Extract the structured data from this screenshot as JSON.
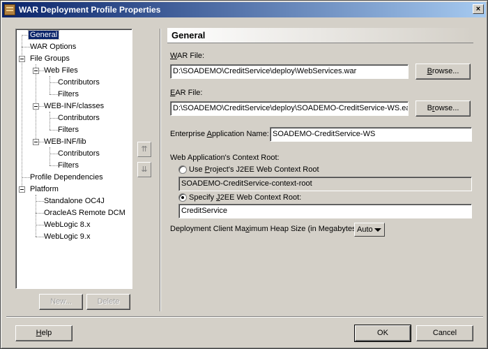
{
  "window": {
    "title": "WAR Deployment Profile Properties",
    "close_glyph": "×"
  },
  "tree": {
    "general": "General",
    "war_options": "WAR Options",
    "file_groups": "File Groups",
    "web_files": "Web Files",
    "web_files_contributors": "Contributors",
    "web_files_filters": "Filters",
    "web_inf_classes": "WEB-INF/classes",
    "classes_contributors": "Contributors",
    "classes_filters": "Filters",
    "web_inf_lib": "WEB-INF/lib",
    "lib_contributors": "Contributors",
    "lib_filters": "Filters",
    "profile_dependencies": "Profile Dependencies",
    "platform": "Platform",
    "standalone_oc4j": "Standalone OC4J",
    "oracleas_remote_dcm": "OracleAS Remote DCM",
    "weblogic_8x": "WebLogic 8.x",
    "weblogic_9x": "WebLogic 9.x"
  },
  "tree_buttons": {
    "new": "New...",
    "delete": "Delete",
    "move_up": "⇈",
    "move_down": "⇊"
  },
  "panel": {
    "header": "General",
    "war_file_label_u": "W",
    "war_file_label_rest": "AR File:",
    "war_file_value": "D:\\SOADEMO\\CreditService\\deploy\\WebServices.war",
    "browse1": "Browse...",
    "ear_file_label_u": "E",
    "ear_file_label_rest": "AR File:",
    "ear_file_value": "D:\\SOADEMO\\CreditService\\deploy\\SOADEMO-CreditService-WS.ear",
    "browse2": "Browse...",
    "enterprise_app_label_a": "Enterprise ",
    "enterprise_app_label_u": "A",
    "enterprise_app_label_b": "pplication Name:",
    "enterprise_app_value": "SOADEMO-CreditService-WS",
    "context_root_label": "Web Application's Context Root:",
    "use_project_label_a": "Use ",
    "use_project_label_u": "P",
    "use_project_label_b": "roject's J2EE Web Context Root",
    "project_root_value": "SOADEMO-CreditService-context-root",
    "specify_label_a": "Specify ",
    "specify_label_u": "J",
    "specify_label_b": "2EE Web Context Root:",
    "specify_value": "CreditService",
    "heap_label_a": "Deployment Client Ma",
    "heap_label_u": "x",
    "heap_label_b": "imum Heap Size (in Megabytes):",
    "heap_value": "Auto"
  },
  "footer": {
    "help_u": "H",
    "help_rest": "elp",
    "ok": "OK",
    "cancel": "Cancel"
  }
}
